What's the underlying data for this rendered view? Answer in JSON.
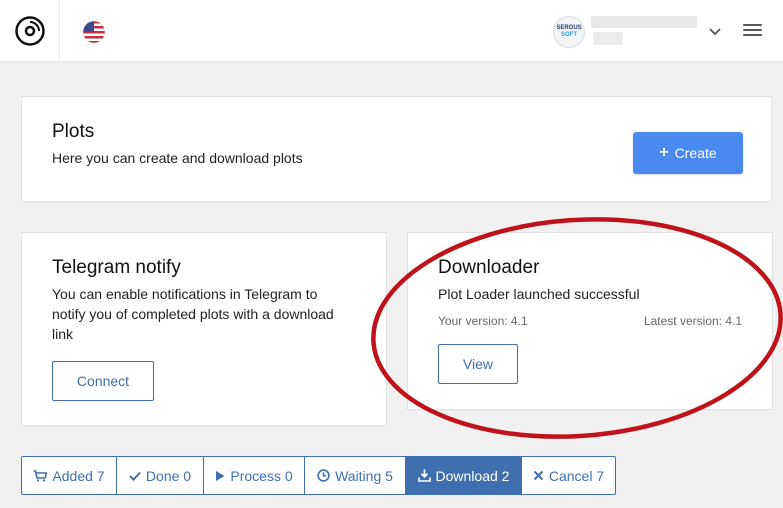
{
  "header": {
    "logo_icon": "disc-logo-icon",
    "language_flag": "us-flag-icon",
    "avatar_text_line1": "SEROUS",
    "avatar_text_line2": "SOFT",
    "menu_icon": "hamburger-icon",
    "dropdown_icon": "chevron-down-icon"
  },
  "plots_card": {
    "title": "Plots",
    "description": "Here you can create and download plots",
    "create_label": "Create"
  },
  "telegram_card": {
    "title": "Telegram notify",
    "description": "You can enable notifications in Telegram to notify you of completed plots with a download link",
    "connect_label": "Connect"
  },
  "downloader_card": {
    "title": "Downloader",
    "status": "Plot Loader launched successful",
    "your_version": "Your version: 4.1",
    "latest_version": "Latest version: 4.1",
    "view_label": "View"
  },
  "filter_tabs": [
    {
      "label": "Added 7",
      "icon": "cart-icon",
      "active": false
    },
    {
      "label": "Done 0",
      "icon": "check-icon",
      "active": false
    },
    {
      "label": "Process 0",
      "icon": "play-icon",
      "active": false
    },
    {
      "label": "Waiting 5",
      "icon": "clock-icon",
      "active": false
    },
    {
      "label": "Download 2",
      "icon": "download-icon",
      "active": true
    },
    {
      "label": "Cancel 7",
      "icon": "times-icon",
      "active": false
    }
  ],
  "colors": {
    "primary": "#4a8af0",
    "outline": "#3f6fae",
    "annotation": "#c0121a"
  }
}
